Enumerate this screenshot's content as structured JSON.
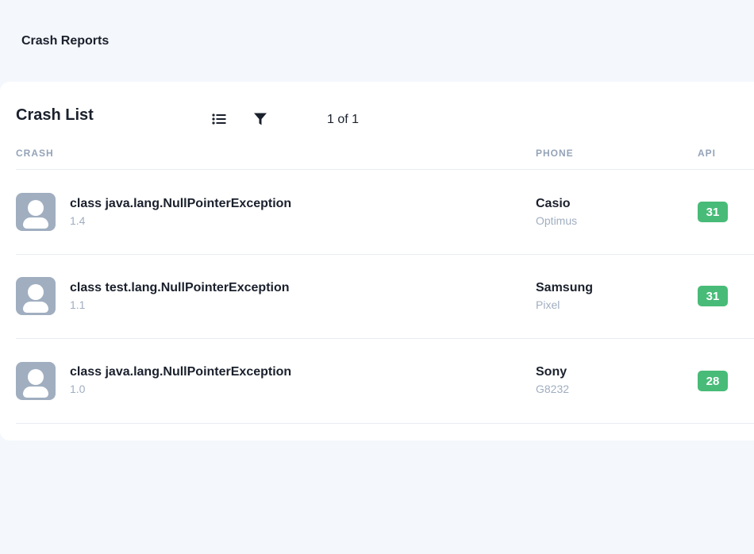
{
  "header": {
    "title": "Crash Reports"
  },
  "card": {
    "title": "Crash List",
    "toolbar": {
      "list_icon": "list-icon",
      "filter_icon": "filter-icon"
    },
    "pager": "1 of 1"
  },
  "columns": {
    "crash": "CRASH",
    "phone": "PHONE",
    "api": "API"
  },
  "rows": [
    {
      "crash": "class java.lang.NullPointerException",
      "version": "1.4",
      "brand": "Casio",
      "model": "Optimus",
      "api": "31"
    },
    {
      "crash": "class test.lang.NullPointerException",
      "version": "1.1",
      "brand": "Samsung",
      "model": "Pixel",
      "api": "31"
    },
    {
      "crash": "class java.lang.NullPointerException",
      "version": "1.0",
      "brand": "Sony",
      "model": "G8232",
      "api": "28"
    }
  ],
  "colors": {
    "background": "#f4f7fb",
    "badge": "#48bb78",
    "avatar": "#a0aec0",
    "muted": "#94a3b8"
  }
}
